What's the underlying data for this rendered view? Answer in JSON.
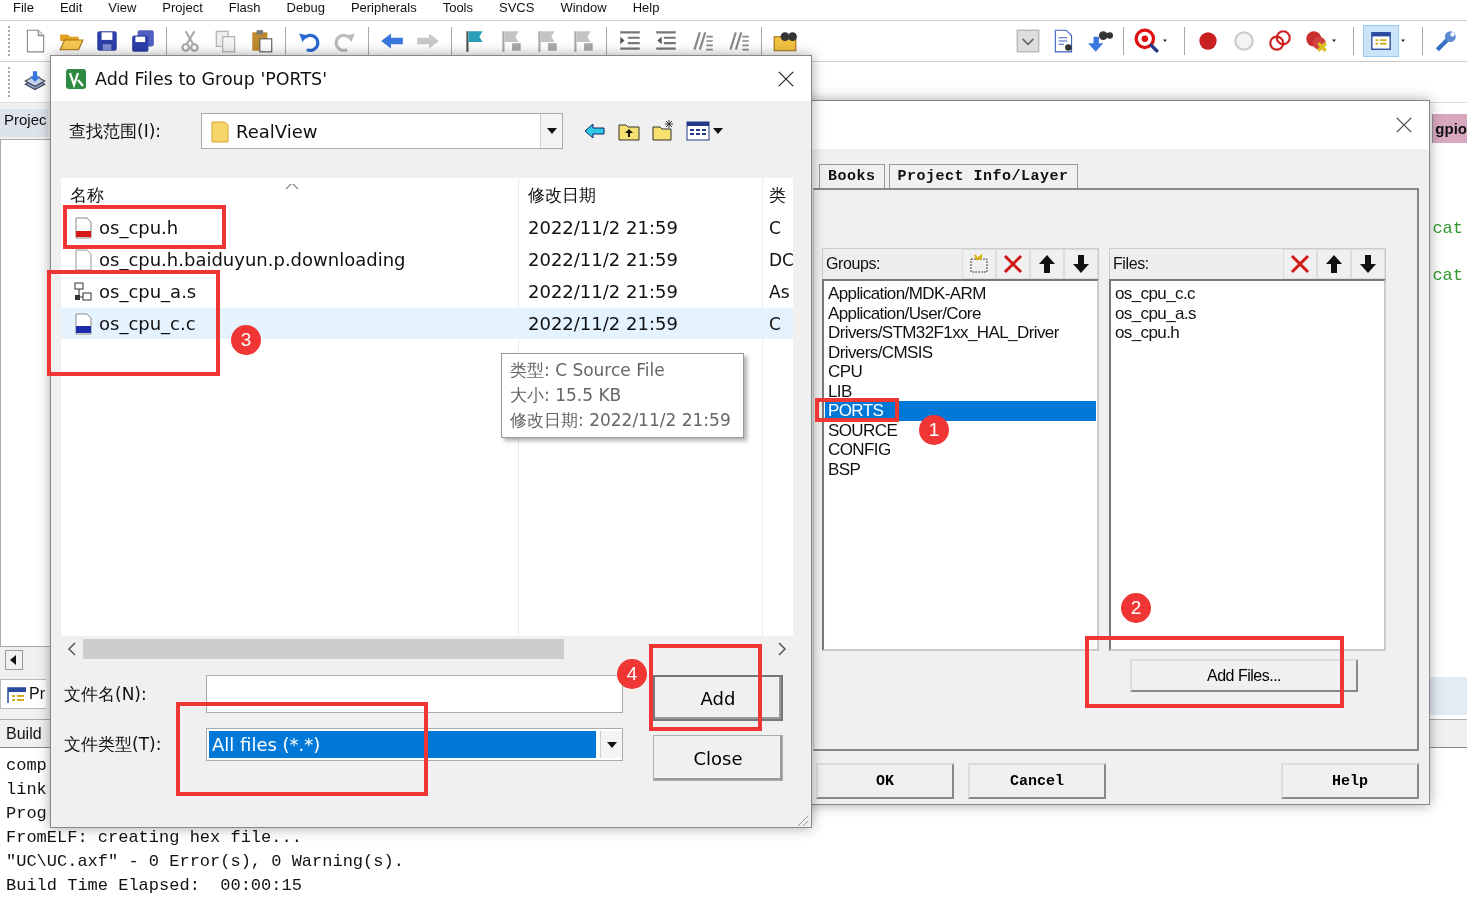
{
  "menu_bar": [
    "File",
    "Edit",
    "View",
    "Project",
    "Flash",
    "Debug",
    "Peripherals",
    "Tools",
    "SVCS",
    "Window",
    "Help"
  ],
  "project_panel": {
    "tab": "Projec",
    "bottom_tab": "Pr"
  },
  "editor": {
    "tab": "gpio",
    "lines": [
      "cat",
      "cat"
    ]
  },
  "build_output": {
    "title": "Build",
    "lines": [
      "comp",
      "link",
      "Prog",
      "FromELF: creating hex file...",
      "\"UC\\UC.axf\" - 0 Error(s), 0 Warning(s).",
      "Build Time Elapsed:  00:00:15"
    ]
  },
  "manage_dialog": {
    "tabs": [
      {
        "label": "Books",
        "selected": false
      },
      {
        "label": "Project Info/Layer",
        "selected": false
      }
    ],
    "groups_label": "Groups:",
    "groups": [
      {
        "name": "Application/MDK-ARM",
        "selected": false
      },
      {
        "name": "Application/User/Core",
        "selected": false
      },
      {
        "name": "Drivers/STM32F1xx_HAL_Driver",
        "selected": false
      },
      {
        "name": "Drivers/CMSIS",
        "selected": false
      },
      {
        "name": "CPU",
        "selected": false
      },
      {
        "name": "LIB",
        "selected": false
      },
      {
        "name": "PORTS",
        "selected": true
      },
      {
        "name": "SOURCE",
        "selected": false
      },
      {
        "name": "CONFIG",
        "selected": false
      },
      {
        "name": "BSP",
        "selected": false
      }
    ],
    "files_label": "Files:",
    "files": [
      "os_cpu_c.c",
      "os_cpu_a.s",
      "os_cpu.h"
    ],
    "add_files_button": "Add Files...",
    "buttons": [
      "OK",
      "Cancel",
      "Help"
    ]
  },
  "add_files_dialog": {
    "title": "Add Files to Group 'PORTS'",
    "look_in_label": "查找范围(I):",
    "look_in": "RealView",
    "columns": [
      "名称",
      "修改日期",
      "类"
    ],
    "files": [
      {
        "name": "os_cpu.h",
        "date": "2022/11/2 21:59",
        "type": "C",
        "kind": "header",
        "selected": false
      },
      {
        "name": "os_cpu.h.baiduyun.p.downloading",
        "date": "2022/11/2 21:59",
        "type": "DC",
        "kind": "plain",
        "selected": false
      },
      {
        "name": "os_cpu_a.s",
        "date": "2022/11/2 21:59",
        "type": "As",
        "kind": "asm",
        "selected": false
      },
      {
        "name": "os_cpu_c.c",
        "date": "2022/11/2 21:59",
        "type": "C",
        "kind": "source",
        "selected": true
      }
    ],
    "tooltip": [
      "类型: C Source File",
      "大小: 15.5 KB",
      "修改日期: 2022/11/2 21:59"
    ],
    "file_name_label": "文件名(N):",
    "file_type_label": "文件类型(T):",
    "file_type": "All files (*.*)",
    "buttons": [
      "Add",
      "Close"
    ]
  },
  "annotations": [
    {
      "label": "1"
    },
    {
      "label": "2"
    },
    {
      "label": "3"
    },
    {
      "label": "4"
    }
  ]
}
